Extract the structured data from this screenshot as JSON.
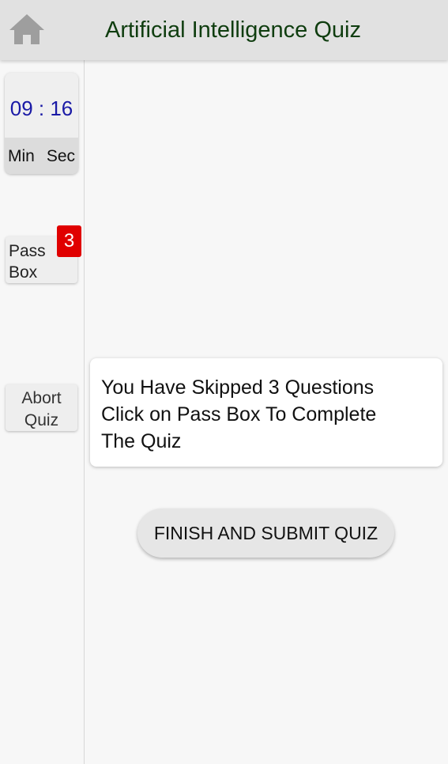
{
  "header": {
    "title": "Artificial Intelligence Quiz",
    "home_icon": "home-icon",
    "home_icon_color": "#9e9e9e",
    "title_color": "#0f3d0f",
    "background": "#e1e1e1"
  },
  "timer": {
    "value": "09 : 16",
    "min_label": "Min",
    "sec_label": "Sec",
    "value_color": "#1a1aa6"
  },
  "pass_box": {
    "label_line1": "Pass",
    "label_line2": "Box",
    "badge_count": "3",
    "badge_color": "#e00000"
  },
  "abort": {
    "label_line1": "Abort",
    "label_line2": "Quiz"
  },
  "message": {
    "line1": "You Have Skipped 3 Questions",
    "line2": "Click on Pass Box To Complete",
    "line3": "The Quiz"
  },
  "finish_button": {
    "label": "FINISH AND SUBMIT QUIZ"
  }
}
